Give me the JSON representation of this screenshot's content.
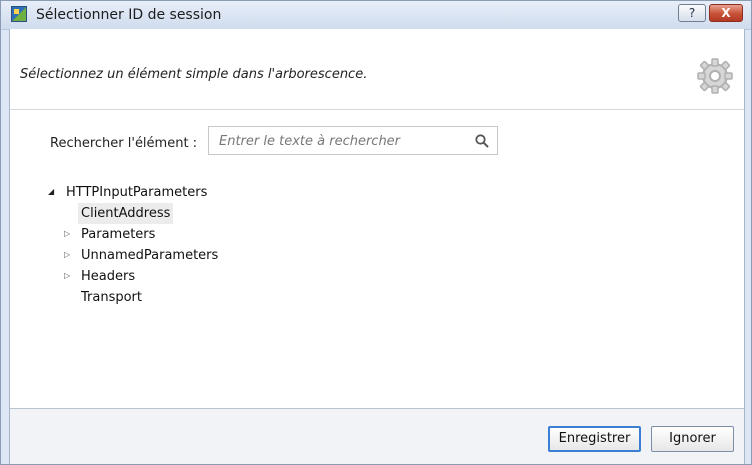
{
  "window": {
    "title": "Sélectionner ID de session",
    "help_label": "?",
    "close_label": "X"
  },
  "dialog": {
    "instruction": "Sélectionnez un élément simple dans l'arborescence.",
    "search": {
      "label": "Rechercher l'élément :",
      "placeholder": "Entrer le texte à rechercher",
      "value": ""
    },
    "tree": {
      "root": "HTTPInputParameters",
      "items": [
        {
          "label": "ClientAddress",
          "expandable": false,
          "selected": true
        },
        {
          "label": "Parameters",
          "expandable": true,
          "selected": false
        },
        {
          "label": "UnnamedParameters",
          "expandable": true,
          "selected": false
        },
        {
          "label": "Headers",
          "expandable": true,
          "selected": false
        },
        {
          "label": "Transport",
          "expandable": false,
          "selected": false
        }
      ]
    }
  },
  "footer": {
    "save_label": "Enregistrer",
    "cancel_label": "Ignorer"
  },
  "icons": [
    "app-icon",
    "help-icon",
    "close-icon",
    "settings-icon",
    "search-icon",
    "expand-icon",
    "collapse-icon"
  ]
}
